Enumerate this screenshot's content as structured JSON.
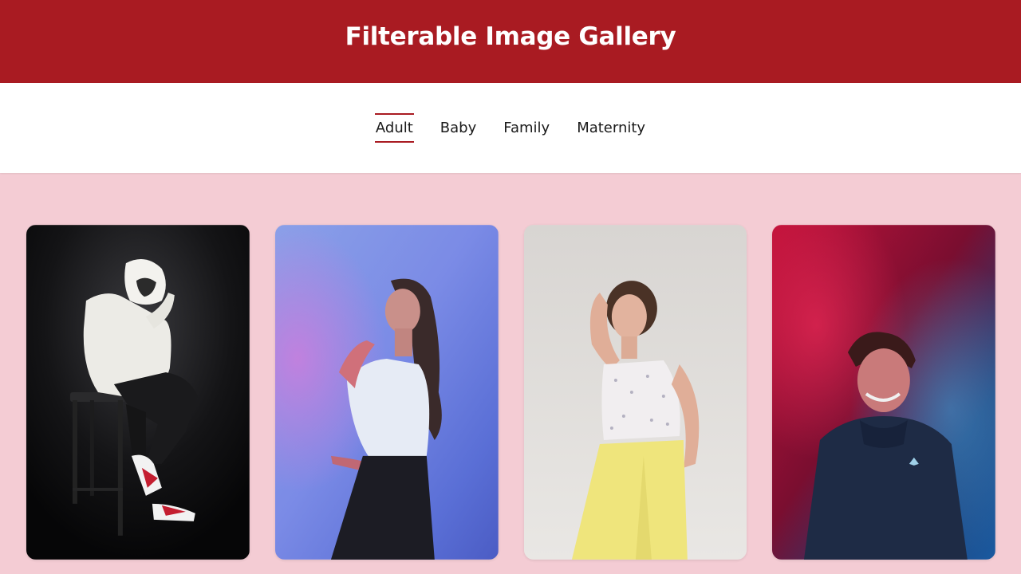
{
  "header": {
    "title": "Filterable Image Gallery"
  },
  "filters": [
    {
      "label": "Adult",
      "active": true
    },
    {
      "label": "Baby",
      "active": false
    },
    {
      "label": "Family",
      "active": false
    },
    {
      "label": "Maternity",
      "active": false
    }
  ],
  "gallery": {
    "images": [
      {
        "subject": "person in white hoodie seated on bar stool, dark background",
        "icon": "photo-icon"
      },
      {
        "subject": "woman in white tank top with blue and pink lighting",
        "icon": "photo-icon"
      },
      {
        "subject": "woman in floral top and yellow trousers, light backdrop",
        "icon": "photo-icon"
      },
      {
        "subject": "smiling man in hoodie with red and blue smoke",
        "icon": "photo-icon"
      }
    ]
  },
  "colors": {
    "header_bg": "#a91b22",
    "page_bg": "#f4ccd4",
    "accent": "#a91b22"
  }
}
